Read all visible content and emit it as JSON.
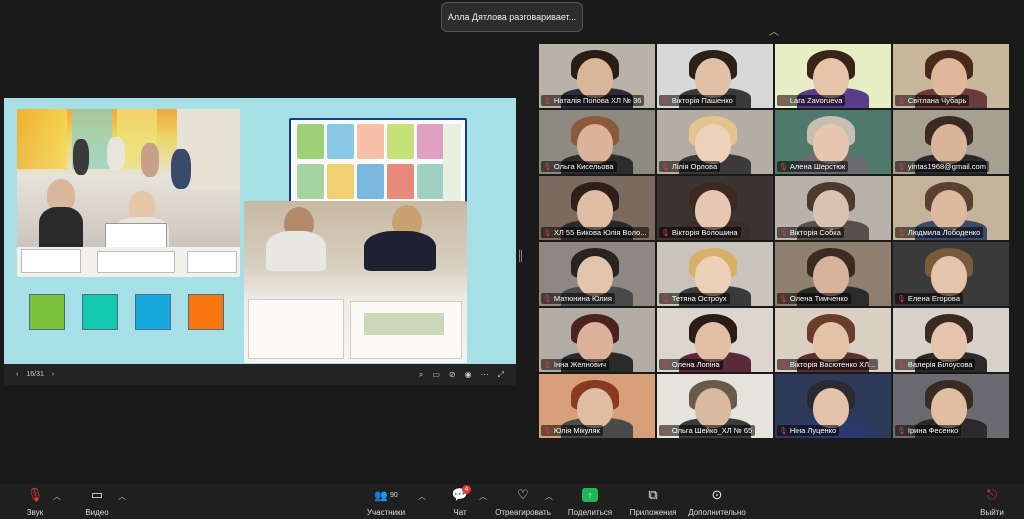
{
  "speaking_indicator": "Алла Дятлова разговаривает...",
  "share": {
    "page_indicator": "16/31",
    "colors": {
      "slide_bg": "#a6dfe6"
    },
    "squares": [
      {
        "color": "#7cc23a"
      },
      {
        "color": "#13c9b0"
      },
      {
        "color": "#17a9dc"
      },
      {
        "color": "#f7760e"
      }
    ]
  },
  "participants": [
    {
      "name": "Наталія Попова ХЛ № 36",
      "skin": "#d9b59a",
      "hair": "#2a1d16",
      "top": "#2b2b3a",
      "bg": "#b9b2a8"
    },
    {
      "name": "Вікторія Пашенко",
      "skin": "#e2c0a6",
      "hair": "#2b2119",
      "top": "#3a3a3a",
      "bg": "#d8d8d8"
    },
    {
      "name": "Lara Zavorueva",
      "skin": "#e6c3a8",
      "hair": "#3a2419",
      "top": "#5a3d8a",
      "bg": "#e7eec4"
    },
    {
      "name": "Світлана Чубарь",
      "skin": "#e1b79b",
      "hair": "#4a2a1c",
      "top": "#6a3b3a",
      "bg": "#c9b79c"
    },
    {
      "name": "Ольга Кисельова",
      "skin": "#dab39a",
      "hair": "#8a5a3a",
      "top": "#2c2c2c",
      "bg": "#8d8a82"
    },
    {
      "name": "Лілія Орлова",
      "skin": "#edd1bb",
      "hair": "#e1c58c",
      "top": "#3a3a3a",
      "bg": "#b5ada4"
    },
    {
      "name": "Алена Шерстюк",
      "skin": "#e6c7ae",
      "hair": "#c8bfb2",
      "top": "#6b6a70",
      "bg": "#4f7a6b"
    },
    {
      "name": "yintas1968@gmail.com",
      "skin": "#d9b39a",
      "hair": "#3a2a22",
      "top": "#2b2b2b",
      "bg": "#a6a093"
    },
    {
      "name": "ХЛ 55 Бикова Юлія Воло...",
      "skin": "#e0bca3",
      "hair": "#2c2018",
      "top": "#2a2a2a",
      "bg": "#7b6a5e"
    },
    {
      "name": "Вікторія Волошина",
      "skin": "#e6c8b2",
      "hair": "#3b2a1f",
      "top": "#3a2d2a",
      "bg": "#3a3432"
    },
    {
      "name": "Вікторія Собка",
      "skin": "#d9c2b0",
      "hair": "#4b3a2d",
      "top": "#55504a",
      "bg": "#b8b2a8"
    },
    {
      "name": "Людмила Лободенко",
      "skin": "#dcb89e",
      "hair": "#5a4030",
      "top": "#3c4a6a",
      "bg": "#c4b39a"
    },
    {
      "name": "Матюнина Юлия",
      "skin": "#e2c3ab",
      "hair": "#2a2420",
      "top": "#4a4a4a",
      "bg": "#8f8882"
    },
    {
      "name": "Тетяна Остроух",
      "skin": "#ecd0b8",
      "hair": "#d8b06a",
      "top": "#3a3a3a",
      "bg": "#c9c4bb"
    },
    {
      "name": "Олена Тимченко",
      "skin": "#d6b29a",
      "hair": "#3a2c22",
      "top": "#2b2b2b",
      "bg": "#8e7f6e"
    },
    {
      "name": "Елена Егорова",
      "skin": "#e4c4aa",
      "hair": "#7a5a3a",
      "top": "#3a3a3a",
      "bg": "#3a3a3a"
    },
    {
      "name": "Інна Желнович",
      "skin": "#dcb29a",
      "hair": "#4a2420",
      "top": "#2a2a2a",
      "bg": "#b3aca4"
    },
    {
      "name": "Олена Лопіна",
      "skin": "#e2bfa5",
      "hair": "#2a1d18",
      "top": "#5a2a3a",
      "bg": "#dcd6cf"
    },
    {
      "name": "Вікторія Васютенко ХЛ...",
      "skin": "#e4c2a8",
      "hair": "#6a3d28",
      "top": "#5a3030",
      "bg": "#d9cfc2"
    },
    {
      "name": "Валерія Білоусова",
      "skin": "#e6c4ab",
      "hair": "#3a2a22",
      "top": "#2a2a2a",
      "bg": "#d7d2ca"
    },
    {
      "name": "Юлія Мікуляк",
      "skin": "#e0bda2",
      "hair": "#8a3a22",
      "top": "#4a4a4a",
      "bg": "#d8a07a"
    },
    {
      "name": "Ольга Шейко_ХЛ № 65",
      "skin": "#d9b9a0",
      "hair": "#6a5a4a",
      "top": "#3a3a3a",
      "bg": "#e6e2dc"
    },
    {
      "name": "Ніна Луценко",
      "skin": "#e2c2a8",
      "hair": "#2a2a30",
      "top": "#2a3a6a",
      "bg": "#2d3a5a"
    },
    {
      "name": "Ірина Фесенко",
      "skin": "#e0bea4",
      "hair": "#3a2a22",
      "top": "#2a2a2a",
      "bg": "#6a6a70"
    }
  ],
  "toolbar": {
    "audio_label": "Звук",
    "video_label": "Видео",
    "participants_label": "Участники",
    "participants_count": "90",
    "chat_label": "Чат",
    "chat_badge": "4",
    "react_label": "Отреагировать",
    "share_label": "Поделиться",
    "apps_label": "Приложения",
    "more_label": "Дополнительно",
    "leave_label": "Выйти"
  }
}
